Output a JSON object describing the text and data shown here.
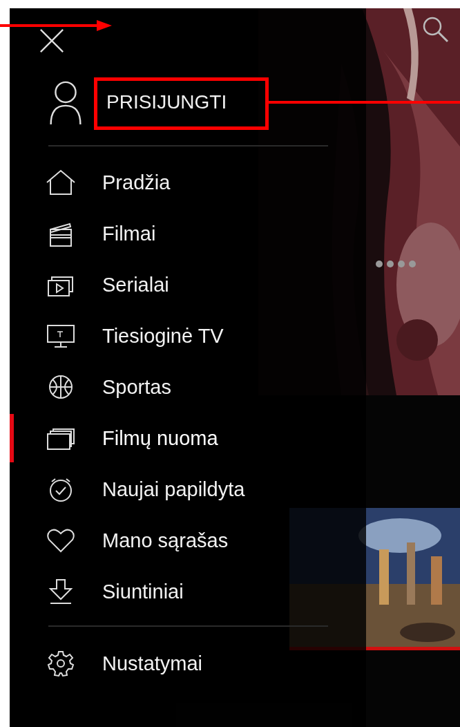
{
  "annotations": [
    {
      "kind": "arrow"
    },
    {
      "kind": "highlight_box"
    },
    {
      "kind": "leader_line"
    }
  ],
  "background": {
    "thumbnail_progress": {
      "level": 1
    }
  },
  "drawer": {
    "login": "PRISIJUNGTI",
    "items": [
      {
        "label": "Pradžia",
        "selected": false
      },
      {
        "label": "Filmai",
        "selected": false
      },
      {
        "label": "Serialai",
        "selected": false
      },
      {
        "label": "Tiesioginė TV",
        "selected": false
      },
      {
        "label": "Sportas",
        "selected": false
      },
      {
        "label": "Filmų nuoma",
        "selected": true
      },
      {
        "label": "Naujai papildyta",
        "selected": false
      },
      {
        "label": "Mano sąrašas",
        "selected": false
      },
      {
        "label": "Siuntiniai",
        "selected": false
      }
    ],
    "settings": {
      "label": "Nustatymai"
    }
  }
}
